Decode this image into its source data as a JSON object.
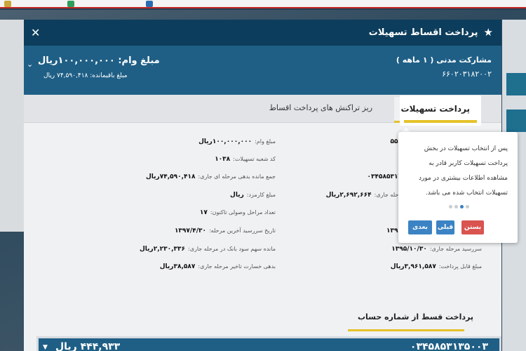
{
  "modal": {
    "title": "پرداخت اقساط تسهیلات",
    "loan_name": "مشارکت مدنی ( ۱ ماهه )",
    "loan_number": "۶۶۰۲۰۳۱۸۲۰۰۲",
    "loan_amount": "مبلغ وام: ۱۰۰,۰۰۰,۰۰۰ریال",
    "remaining": "مبلغ باقیمانده: ۷۴,۵۹۰,۴۱۸ ریال"
  },
  "tabs": {
    "active": "پرداخت تسهیلات",
    "other": "ریز تراکنش های پرداخت اقساط"
  },
  "details_left": [
    {
      "label": "مبلغ وام:",
      "value": "۱۰۰,۰۰۰,۰۰۰ریال"
    },
    {
      "label": "کد شعبه تسهیلات:",
      "value": "۱۰۳۸"
    },
    {
      "label": "جمع مانده بدهی مرحله ای جاری:",
      "value": "۷۴,۵۹۰,۴۱۸ریال"
    },
    {
      "label": "مبلغ کارمزد:",
      "value": "ریال"
    },
    {
      "label": "تعداد مراحل وصولی تاکنون:",
      "value": "۱۷"
    },
    {
      "label": "تاریخ سررسید آخرین مرحله:",
      "value": "۱۳۹۷/۴/۳۰"
    },
    {
      "label": "مانده سهم سود بانک در مرحله جاری:",
      "value": "۲,۲۳۰,۳۳۶ریال"
    },
    {
      "label": "بدهی خسارت تاخیر مرحله جاری:",
      "value": "۳۸,۵۸۷ریال"
    }
  ],
  "details_right": [
    {
      "label": "",
      "value": "۵۵۱"
    },
    {
      "label": "",
      "value": "۰۳۴۵۸۵۳۱۳"
    },
    {
      "label": "مرحله جاری:",
      "value": "۲,۶۹۲,۶۶۴ریال"
    },
    {
      "label": "",
      "value": ""
    },
    {
      "label": "",
      "value": ""
    },
    {
      "label": "",
      "value": "۱۳۹۶"
    },
    {
      "label": "سررسید مرحله جاری:",
      "value": "۱۳۹۵/۱۰/۳۰"
    },
    {
      "label": "مبلغ قابل پرداخت:",
      "value": "۳,۹۶۱,۵۸۷ریال"
    }
  ],
  "payment_section": {
    "title": "پرداخت قسط از شماره حساب",
    "account_number": "۰۳۴۵۸۵۳۱۳۵۰۰۳",
    "account_amount": "۴۴۴,۹۳۳ ریال"
  },
  "tour": {
    "tab_label": "پرداخت تسهیلات",
    "text": "پس از انتخاب تسهیلات در بخش پرداخت تسهیلات کاربر قادر به مشاهده اطلاعات بیشتری در مورد تسهیلات انتخاب شده می باشد.",
    "step_count": 4,
    "current_step": 2,
    "close_label": "بستن",
    "prev_label": "قبلی",
    "next_label": "بعدی"
  },
  "icons": {
    "title": "star-icon",
    "close": "close-icon",
    "expand": "chevron-down-icon"
  },
  "colors": {
    "header": "#0d3d5c",
    "band": "#1f5f86",
    "accent": "#e5c22a",
    "danger": "#d9534f",
    "primary": "#3b83c4"
  }
}
